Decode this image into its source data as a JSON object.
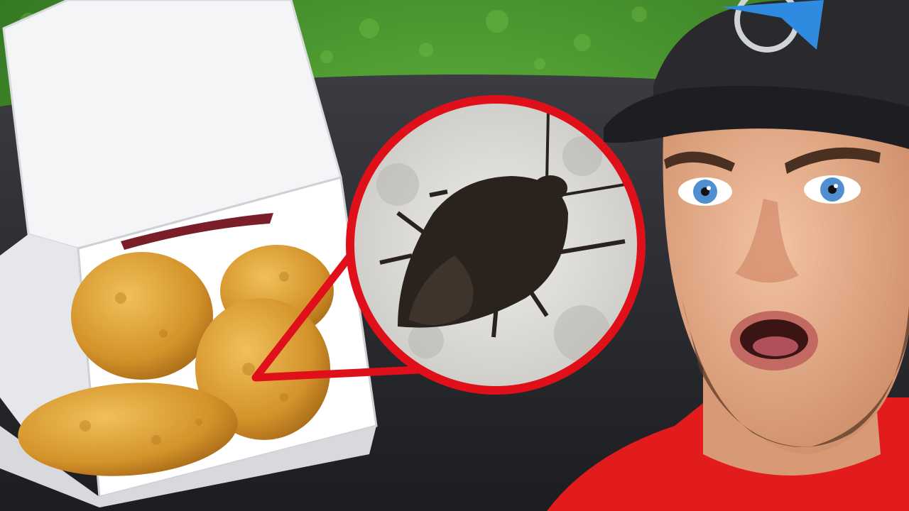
{
  "scene": {
    "description_visible_text": "",
    "colors": {
      "grass": "#3f8f2a",
      "table": "#2b2d31",
      "box": "#f3f4f6",
      "nugget": "#d99a2b",
      "callout": "#e0101a",
      "bug": "#2a221c",
      "shirt": "#e21c1c",
      "cap": "#2a2a2e",
      "cap_logo": "#2f8be0",
      "skin": "#e9b08e"
    },
    "icons": {
      "cap_logo": "stylized-blue-bird-logo"
    }
  }
}
